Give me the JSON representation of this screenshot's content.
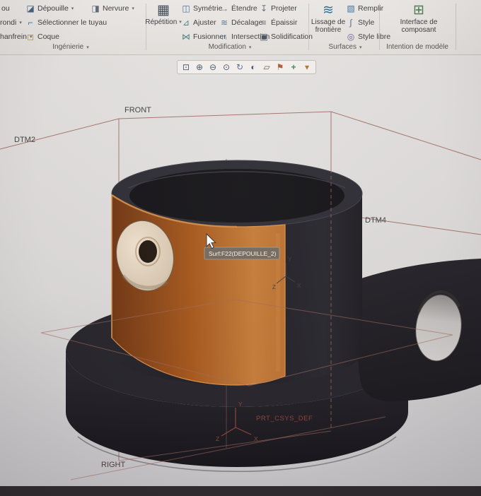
{
  "ribbon": {
    "dropdown_arrow": "▾",
    "groups": {
      "ingenierie": {
        "caption": "Ingénierie",
        "buttons": {
          "trou": "ou",
          "depouille": "Dépouille",
          "nervure": "Nervure",
          "arrondi": "rondi",
          "tuyau": "Sélectionner le tuyau",
          "chanfrein": "hanfrein",
          "coque": "Coque"
        }
      },
      "modification": {
        "caption": "Modification",
        "big_button": "Répétition",
        "buttons": {
          "symetrie": "Symétrie",
          "etendre": "Étendre",
          "projeter": "Projeter",
          "ajuster": "Ajuster",
          "decalage": "Décalage",
          "epaissir": "Épaissir",
          "fusionner": "Fusionner",
          "intersection": "Intersection",
          "solidification": "Solidification"
        }
      },
      "surfaces": {
        "caption": "Surfaces",
        "big_button": "Lissage de frontière",
        "buttons": {
          "remplir": "Remplir",
          "style": "Style",
          "style_libre": "Style libre"
        }
      },
      "intention": {
        "caption": "Intention de modèle",
        "big_button": "Interface de composant"
      }
    }
  },
  "graphics_toolbar": {
    "icon_names": [
      "zoom-window-icon",
      "zoom-in-icon",
      "zoom-out-icon",
      "refit-icon",
      "repaint-icon",
      "display-style-icon",
      "datum-display-icon",
      "annotation-display-icon",
      "spin-center-icon",
      "view-options-icon"
    ]
  },
  "icons": {
    "depouille": "◪",
    "tuyau": "⌐",
    "coque": "◻",
    "nervure": "◨",
    "repetition": "▦",
    "symetrie": "◫",
    "etendre": "→",
    "projeter": "↧",
    "ajuster": "⊿",
    "decalage": "≋",
    "epaissir": "≡",
    "fusionner": "⋈",
    "intersection": "∩",
    "solidification": "▣",
    "lissage": "≋",
    "remplir": "▧",
    "style": "∫",
    "style_libre": "◎",
    "interface": "⊞",
    "toolbar": [
      "⊡",
      "⊕",
      "⊖",
      "⊙",
      "↻",
      "◐",
      "▱",
      "⚑",
      "+",
      "▾"
    ]
  },
  "viewport": {
    "labels": {
      "front": "FRONT",
      "dtm2": "DTM2",
      "dtm4": "DTM4",
      "right": "RIGHT",
      "csys": "PRT_CSYS_DEF"
    },
    "axes": {
      "x": "X",
      "y": "Y",
      "z": "Z"
    },
    "tooltip": "Surf:F22(DEPOUILLE_2)",
    "colors": {
      "highlight_surface": "#b4641f",
      "part": "#1b1a1f",
      "datum_lines": "#99615a",
      "hole_face": "#e3d4c1"
    }
  }
}
